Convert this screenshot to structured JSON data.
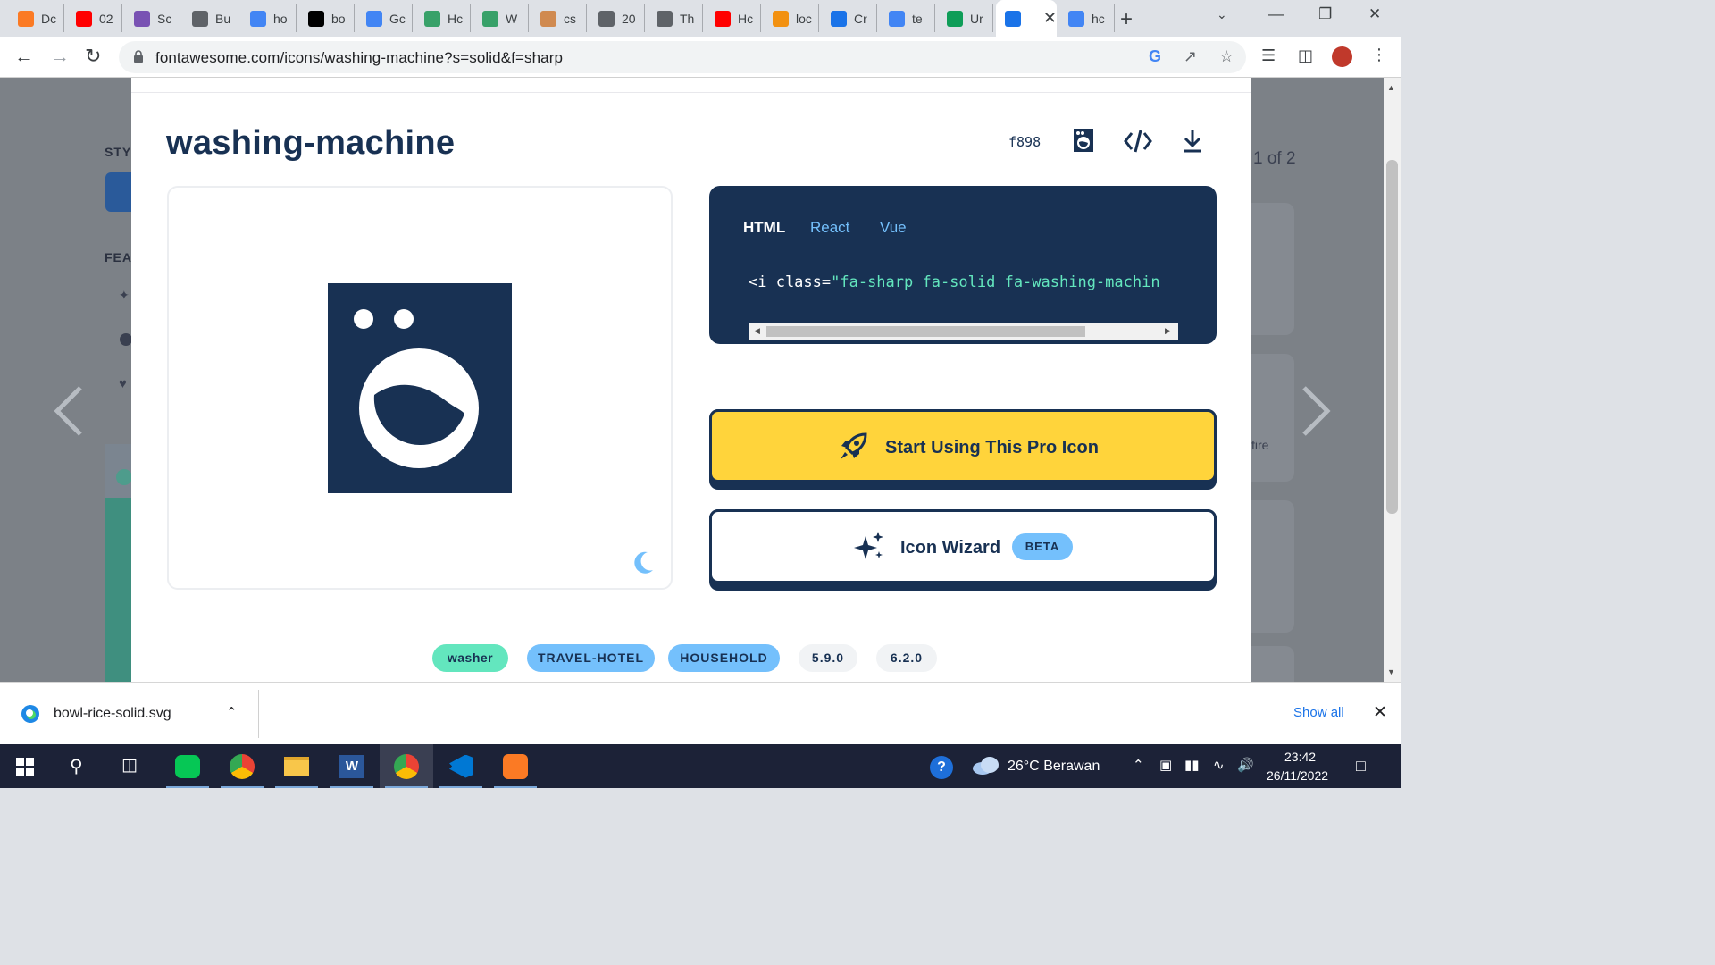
{
  "browser": {
    "tabs": [
      {
        "label": "Dc",
        "icon": "xampp-icon",
        "color": "#fb7a24"
      },
      {
        "label": "02",
        "icon": "youtube-icon",
        "color": "#ff0000"
      },
      {
        "label": "Sc",
        "icon": "bootstrap-icon",
        "color": "#7952b3"
      },
      {
        "label": "Bu",
        "icon": "building-icon",
        "color": "#5f6368"
      },
      {
        "label": "ho",
        "icon": "google-icon",
        "color": "#4285f4"
      },
      {
        "label": "bo",
        "icon": "medium-icon",
        "color": "#000000"
      },
      {
        "label": "Gc",
        "icon": "google-translate-icon",
        "color": "#4285f4"
      },
      {
        "label": "Hc",
        "icon": "wikihow-icon",
        "color": "#38a169"
      },
      {
        "label": "W",
        "icon": "wikihow-icon",
        "color": "#38a169"
      },
      {
        "label": "cs",
        "icon": "pen-icon",
        "color": "#d08a50"
      },
      {
        "label": "20",
        "icon": "loading-icon",
        "color": "#5f6368"
      },
      {
        "label": "Th",
        "icon": "graduation-cap-icon",
        "color": "#5f6368"
      },
      {
        "label": "Hc",
        "icon": "youtube-icon",
        "color": "#ff0000"
      },
      {
        "label": "loc",
        "icon": "pma-icon",
        "color": "#f29111"
      },
      {
        "label": "Cr",
        "icon": "cp-icon",
        "color": "#1a73e8"
      },
      {
        "label": "te",
        "icon": "google-icon",
        "color": "#4285f4"
      },
      {
        "label": "Ur",
        "icon": "plus-square-icon",
        "color": "#0f9d58"
      },
      {
        "label": "",
        "icon": "flag-icon",
        "color": "#1a73e8",
        "active": true
      },
      {
        "label": "hc",
        "icon": "google-icon",
        "color": "#4285f4"
      }
    ],
    "url": "fontawesome.com/icons/washing-machine?s=solid&f=sharp"
  },
  "background": {
    "style_label": "STY",
    "feature_label": "FEA",
    "pager_text": "1 of 2",
    "side_text": "fire"
  },
  "modal": {
    "title": "washing-machine",
    "unicode": "f898",
    "code_tabs": [
      "HTML",
      "React",
      "Vue"
    ],
    "code_prefix": "<i class=",
    "code_string": "\"fa-sharp fa-solid fa-washing-machin",
    "start_button": "Start Using This Pro Icon",
    "wizard_button": "Icon Wizard",
    "beta_badge": "BETA",
    "tags": [
      {
        "label": "washer",
        "color": "#63e6be"
      },
      {
        "label": "TRAVEL-HOTEL",
        "color": "#74c0fc"
      },
      {
        "label": "HOUSEHOLD",
        "color": "#74c0fc"
      },
      {
        "label": "5.9.0",
        "color": "#f1f3f5"
      },
      {
        "label": "6.2.0",
        "color": "#f1f3f5"
      }
    ],
    "colors": {
      "navy": "#183153",
      "yellow": "#ffd43b",
      "teal": "#63e6be",
      "sky": "#74c0fc"
    }
  },
  "download_bar": {
    "file_name": "bowl-rice-solid.svg",
    "show_all": "Show all"
  },
  "taskbar": {
    "weather": "26°C  Berawan",
    "time": "23:42",
    "date": "26/11/2022"
  }
}
